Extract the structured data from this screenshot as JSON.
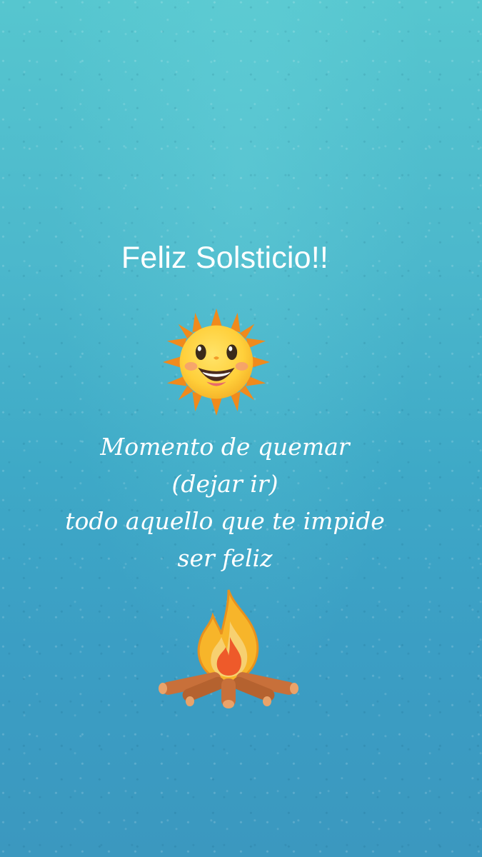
{
  "title": "Feliz Solsticio!!",
  "message": {
    "line1": "Momento de quemar",
    "line2": "(dejar ir)",
    "line3": "todo aquello que te impide",
    "line4": "ser feliz"
  },
  "icons": {
    "sun": "smiling-sun-emoji",
    "fire": "campfire-emoji"
  },
  "colors": {
    "background_top": "#56c6cf",
    "background_bottom": "#3b98bf",
    "text": "#ffffff",
    "sun_face": "#ffcf3a",
    "sun_rays": "#f08a1c",
    "flame_outer": "#f7b52a",
    "flame_inner": "#ee5a2a",
    "logs": "#c8703a"
  }
}
